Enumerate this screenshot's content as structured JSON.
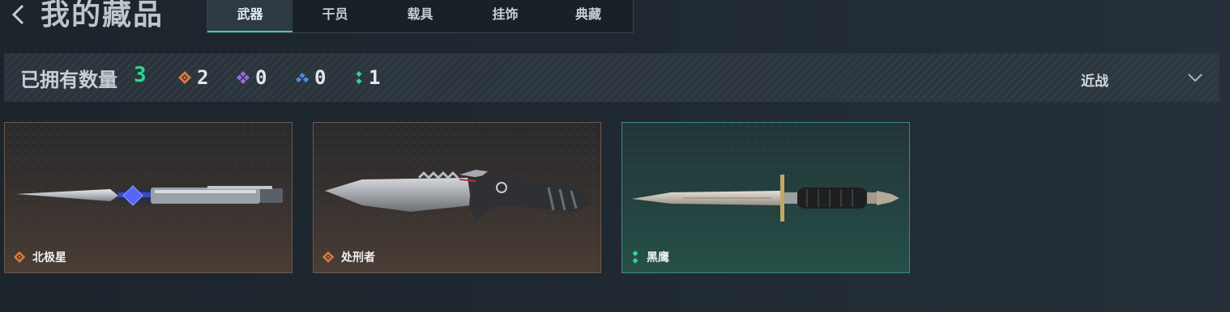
{
  "header": {
    "title": "我的藏品",
    "back_icon": "chevron-left-icon"
  },
  "tabs": [
    {
      "label": "武器",
      "active": true
    },
    {
      "label": "干员",
      "active": false
    },
    {
      "label": "载具",
      "active": false
    },
    {
      "label": "挂饰",
      "active": false
    },
    {
      "label": "典藏",
      "active": false
    }
  ],
  "stats": {
    "owned_label": "已拥有数量",
    "owned_count": "3",
    "rarities": [
      {
        "icon": "orange-diamond-icon",
        "color": "#e07a3a",
        "count": "2"
      },
      {
        "icon": "purple-diamond-icon",
        "color": "#9a6ae0",
        "count": "0"
      },
      {
        "icon": "blue-diamond-icon",
        "color": "#4a90e2",
        "count": "0"
      },
      {
        "icon": "green-diamond-icon",
        "color": "#2fd58e",
        "count": "1"
      }
    ],
    "filter": {
      "selected": "近战",
      "icon": "chevron-down-icon"
    }
  },
  "items": [
    {
      "name": "北极星",
      "rarity": "orange",
      "rarity_color": "#e07a3a",
      "icon": "knife-image"
    },
    {
      "name": "处刑者",
      "rarity": "orange",
      "rarity_color": "#e07a3a",
      "icon": "knife-image"
    },
    {
      "name": "黑鹰",
      "rarity": "green",
      "rarity_color": "#2fd58e",
      "icon": "knife-image"
    }
  ],
  "colors": {
    "accent": "#3ccf9a",
    "owned_count": "#2fd58e"
  }
}
